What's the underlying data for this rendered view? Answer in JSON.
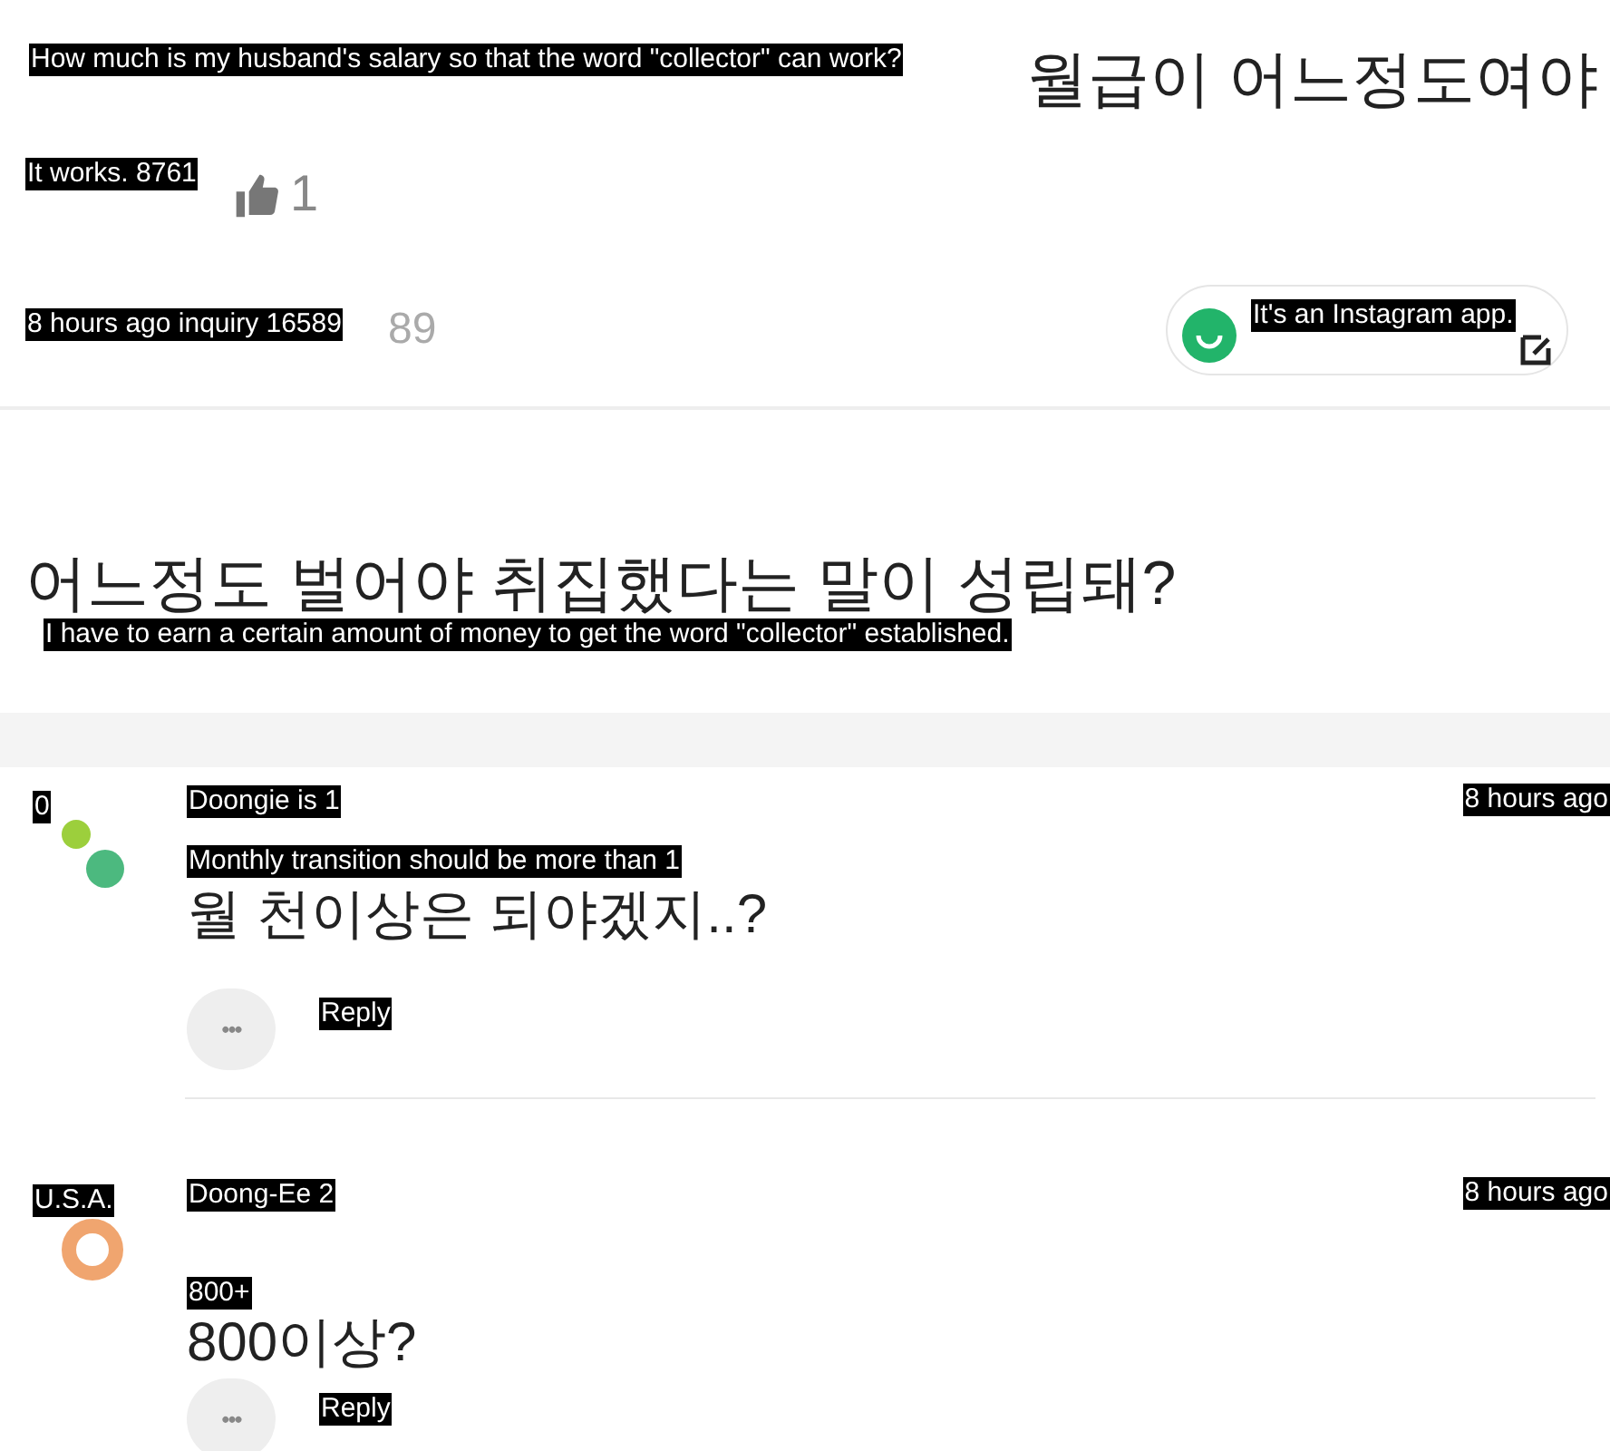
{
  "question": {
    "title_caption": "How much is my husband's salary so that the word \"collector\" can work?",
    "title_tail": "월급이 어느정도여야",
    "stats_caption": "It works. 8761",
    "likes": "1",
    "meta_caption": "8 hours ago inquiry 16589",
    "views_tail": "89",
    "translate_caption": "It's an Instagram app."
  },
  "headline": {
    "text": "어느정도 벌어야 취집했다는 말이 성립돼?",
    "caption": "I have to earn a certain amount of money to get the word \"collector\" established."
  },
  "comments": [
    {
      "kind": "dots",
      "badge": "0",
      "author": "Doongie is 1",
      "time": "8 hours ago",
      "caption": "Monthly transition should be more than 1",
      "text": "월 천이상은 되야겠지..?",
      "more": "•••",
      "reply": "Reply"
    },
    {
      "kind": "ring",
      "badge": "U.S.A.",
      "author": "Doong-Ee 2",
      "time": "8 hours ago",
      "caption": "800+",
      "text": "800이상?",
      "more": "•••",
      "reply": "Reply"
    }
  ]
}
